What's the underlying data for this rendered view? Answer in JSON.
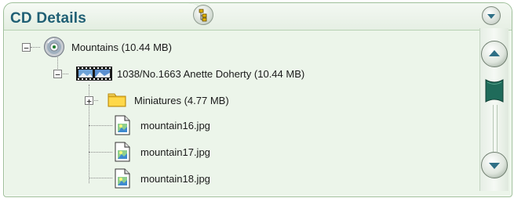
{
  "panel": {
    "title": "CD Details",
    "icons": {
      "tool": "tree-view-icon",
      "menu": "chevron-down-icon"
    }
  },
  "tree": [
    {
      "label": "Mountains (10.44 MB)",
      "icon": "disc-icon",
      "expanded": true
    },
    {
      "label": "1038/No.1663  Anette Doherty (10.44 MB)",
      "icon": "film-strip-icon",
      "expanded": true
    },
    {
      "label": "Miniatures (4.77 MB)",
      "icon": "folder-icon",
      "expanded": false
    },
    {
      "label": "mountain16.jpg",
      "icon": "image-file-icon"
    },
    {
      "label": "mountain17.jpg",
      "icon": "image-file-icon"
    },
    {
      "label": "mountain18.jpg",
      "icon": "image-file-icon"
    }
  ],
  "toggles": {
    "collapse": "−",
    "expand": "+"
  },
  "colors": {
    "title": "#1f5f74",
    "panel_bg": "#ecf5ea",
    "thumb": "#1f6b5a"
  }
}
